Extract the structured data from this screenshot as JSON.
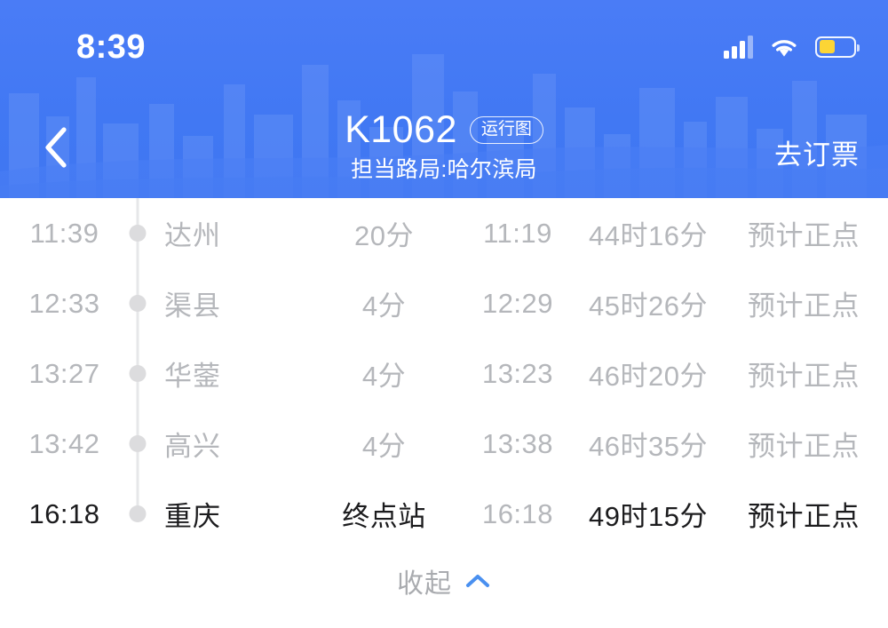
{
  "status_bar": {
    "time": "8:39",
    "signal_icon": "signal-bars-icon",
    "signal_bars_filled": 3,
    "signal_bars_total": 4,
    "wifi_icon": "wifi-icon",
    "battery_icon": "battery-icon",
    "battery_level_percent": 46,
    "battery_color": "#fcd535"
  },
  "header": {
    "background_color": "#4479f4",
    "back_icon": "chevron-left-icon",
    "title": "K1062",
    "badge_label": "运行图",
    "subtitle": "担当路局:哈尔滨局",
    "action_label": "去订票"
  },
  "schedule": {
    "timeline_dot_color": "#dcdcde",
    "timeline_line_color": "#e6e7e9",
    "rows": [
      {
        "depart": "11:39",
        "station": "达州",
        "stop_duration": "20分",
        "arrive": "11:19",
        "elapsed": "44时16分",
        "status": "预计正点",
        "emphasis": "dim"
      },
      {
        "depart": "12:33",
        "station": "渠县",
        "stop_duration": "4分",
        "arrive": "12:29",
        "elapsed": "45时26分",
        "status": "预计正点",
        "emphasis": "dim"
      },
      {
        "depart": "13:27",
        "station": "华蓥",
        "stop_duration": "4分",
        "arrive": "13:23",
        "elapsed": "46时20分",
        "status": "预计正点",
        "emphasis": "dim"
      },
      {
        "depart": "13:42",
        "station": "高兴",
        "stop_duration": "4分",
        "arrive": "13:38",
        "elapsed": "46时35分",
        "status": "预计正点",
        "emphasis": "dim"
      },
      {
        "depart": "16:18",
        "station": "重庆",
        "stop_duration": "终点站",
        "arrive": "16:18",
        "elapsed": "49时15分",
        "status": "预计正点",
        "emphasis": "strong"
      }
    ]
  },
  "collapse": {
    "label": "收起",
    "icon": "chevron-up-icon",
    "icon_color": "#4a90f0"
  }
}
